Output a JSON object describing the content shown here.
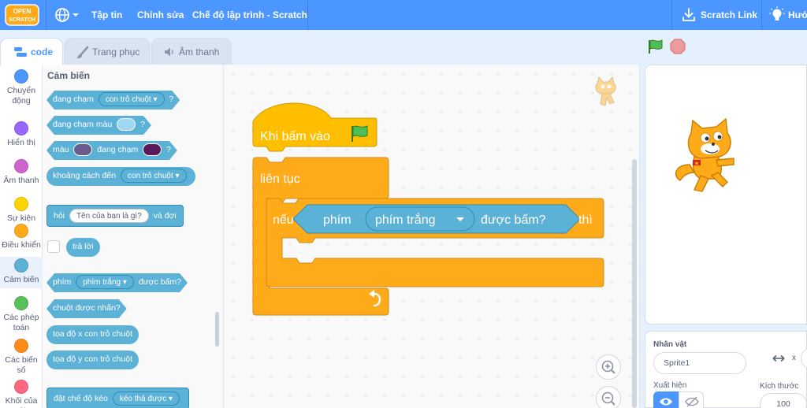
{
  "menubar": {
    "logo_text_top": "OPEN",
    "logo_text_bottom": "SCRATCH",
    "file": "Tập tin",
    "edit": "Chỉnh sửa",
    "mode": "Chế độ lập trình - Scratch",
    "scratch_link": "Scratch Link",
    "tutorials": "Hướ",
    "color": "#4c97ff"
  },
  "tabs": {
    "code": "code",
    "costumes": "Trang phục",
    "sounds": "Âm thanh"
  },
  "categories": [
    {
      "label": "Chuyển động",
      "color": "#4c97ff"
    },
    {
      "label": "Hiển thị",
      "color": "#9966ff"
    },
    {
      "label": "Âm thanh",
      "color": "#cf63cf"
    },
    {
      "label": "Sự kiện",
      "color": "#ffd500"
    },
    {
      "label": "Điều khiển",
      "color": "#ffab19"
    },
    {
      "label": "Cảm biến",
      "color": "#5cb1d6"
    },
    {
      "label": "Các phép toán",
      "color": "#59c059"
    },
    {
      "label": "Các biến số",
      "color": "#ff8c1a"
    },
    {
      "label": "Khối của tôi",
      "color": "#ff6680"
    }
  ],
  "palette": {
    "title": "Cảm biến",
    "touching": "đang chạm",
    "touching_target": "con trỏ chuột",
    "q": "?",
    "touching_color": "đang chạm màu",
    "color_word": "màu",
    "color_touching": "đang chạm",
    "distance_to": "khoảng cách đến",
    "distance_target": "con trỏ chuột",
    "ask": "hỏi",
    "ask_text": "Tên của bạn là gì?",
    "and_wait": "và đợi",
    "answer": "trả lời",
    "key": "phím",
    "key_name": "phím trắng",
    "pressed": "được bấm?",
    "mouse_down": "chuột được nhấn?",
    "mouse_x": "tọa độ x con trỏ chuột",
    "mouse_y": "tọa độ y con trỏ chuột",
    "drag_mode": "đặt chế độ kéo",
    "drag_value": "kéo thả được",
    "colors": {
      "touch_color": "#9fd6f1",
      "color_a": "#6b5c8e",
      "color_b": "#5a1a5a"
    }
  },
  "script": {
    "hat": "Khi bấm vào",
    "forever": "liên tục",
    "if": "nếu",
    "key": "phím",
    "key_name": "phím trắng",
    "pressed": "được bấm?",
    "then": "thì",
    "colors": {
      "events": "#ffbf00",
      "control": "#ffab19",
      "sensing": "#5cb1d6"
    }
  },
  "stage": {
    "green_flag": "green-flag-icon",
    "stop": "stop-icon"
  },
  "sprite_panel": {
    "sprite_label": "Nhân vật",
    "sprite_name": "Sprite1",
    "x_label": "x",
    "show_label": "Xuất hiện",
    "size_label": "Kích thước",
    "size_value": "100"
  }
}
